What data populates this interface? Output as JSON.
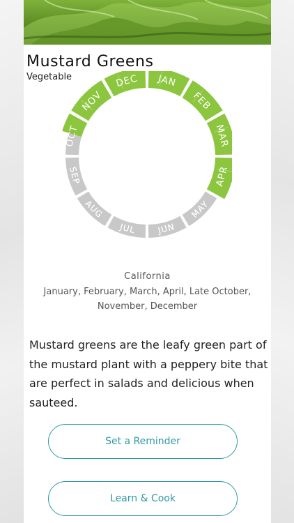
{
  "produce": {
    "name": "Mustard Greens",
    "category": "Vegetable"
  },
  "season_wheel": {
    "months": [
      "JAN",
      "FEB",
      "MAR",
      "APR",
      "MAY",
      "JUN",
      "JUL",
      "AUG",
      "SEP",
      "OCT",
      "NOV",
      "DEC"
    ],
    "in_season": [
      "JAN",
      "FEB",
      "MAR",
      "APR",
      "OCT",
      "NOV",
      "DEC"
    ],
    "partial_months": [
      "OCT"
    ],
    "in_season_color": "#8cc63f",
    "off_season_color": "#c8c8c8"
  },
  "availability": {
    "region": "California",
    "months_text": "January, February, March, April, Late October, November, December"
  },
  "description": "Mustard greens are the leafy green part of the mustard plant with a peppery bite that are perfect in salads and delicious when sauteed.",
  "actions": {
    "reminder_label": "Set a Reminder",
    "cook_label": "Learn & Cook"
  },
  "colors": {
    "accent": "#2e9aa5",
    "leaf_green": "#8cc63f"
  }
}
